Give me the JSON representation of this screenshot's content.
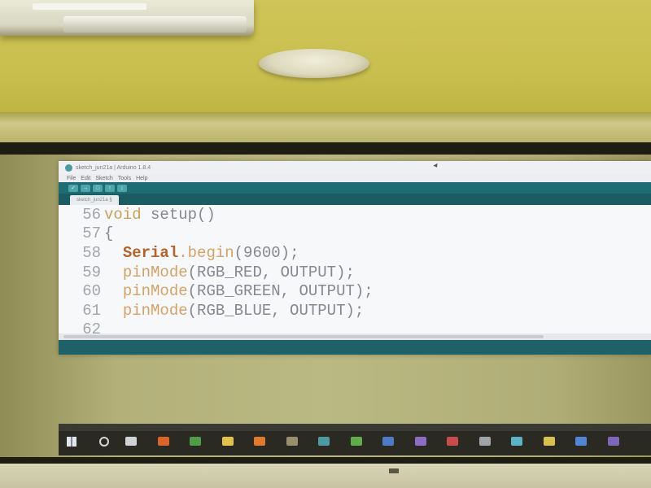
{
  "window": {
    "title": "sketch_jun21a | Arduino 1.8.4"
  },
  "menu": [
    "File",
    "Edit",
    "Sketch",
    "Tools",
    "Help"
  ],
  "toolbar": {
    "buttons": [
      {
        "name": "verify",
        "glyph": "✓"
      },
      {
        "name": "upload",
        "glyph": "→"
      },
      {
        "name": "new",
        "glyph": "□"
      },
      {
        "name": "open",
        "glyph": "↑"
      },
      {
        "name": "save",
        "glyph": "↓"
      }
    ]
  },
  "tab": {
    "label": "sketch_jun21a §"
  },
  "code": {
    "lines": [
      {
        "num": "56",
        "keyword": "void",
        "text": " setup()"
      },
      {
        "num": "57",
        "text": "{"
      },
      {
        "num": "58",
        "indent": "  ",
        "object": "Serial",
        "method": ".begin",
        "text": "(9600);"
      },
      {
        "num": "59",
        "indent": "  ",
        "method": "pinMode",
        "text": "(RGB_RED, OUTPUT);"
      },
      {
        "num": "60",
        "indent": "  ",
        "method": "pinMode",
        "text": "(RGB_GREEN, OUTPUT);"
      },
      {
        "num": "61",
        "indent": "  ",
        "method": "pinMode",
        "text": "(RGB_BLUE, OUTPUT);"
      },
      {
        "num": "62",
        "text": ""
      }
    ]
  },
  "taskbar": {
    "icons": [
      {
        "name": "task-view",
        "color": "#cfd3d8"
      },
      {
        "name": "firefox",
        "color": "#d9652b"
      },
      {
        "name": "chrome",
        "color": "#4f9d4b"
      },
      {
        "name": "file-explorer",
        "color": "#e3c04a"
      },
      {
        "name": "firefox-2",
        "color": "#e07a2c"
      },
      {
        "name": "misc-app",
        "color": "#9a8f6c"
      },
      {
        "name": "arduino-ide",
        "color": "#4e9aa3"
      },
      {
        "name": "app-green",
        "color": "#5fae4a"
      },
      {
        "name": "app-blue",
        "color": "#4d79c7"
      },
      {
        "name": "app-purple",
        "color": "#8d6cc4"
      },
      {
        "name": "app-red",
        "color": "#c94c4c"
      },
      {
        "name": "app-gray",
        "color": "#9fa4a8"
      },
      {
        "name": "app-cyan",
        "color": "#5bb3c7"
      },
      {
        "name": "app-yellow",
        "color": "#d8c04c"
      },
      {
        "name": "app-blue-2",
        "color": "#4f87d6"
      },
      {
        "name": "app-purple-2",
        "color": "#7d68b8"
      }
    ]
  }
}
